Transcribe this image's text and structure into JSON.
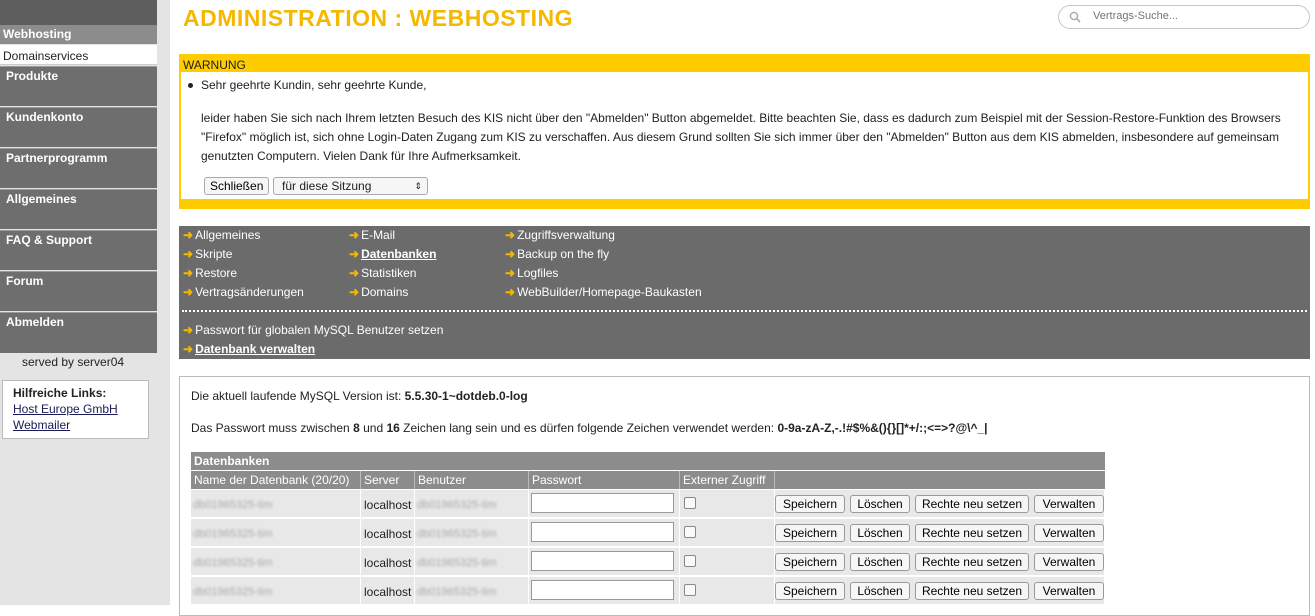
{
  "sidebar": {
    "active_section": "Webhosting",
    "sub_item": "Domainservices",
    "items": [
      "Produkte",
      "Kundenkonto",
      "Partnerprogramm",
      "Allgemeines",
      "FAQ & Support",
      "Forum",
      "Abmelden"
    ],
    "served_by": "served by server04",
    "links_title": "Hilfreiche Links:",
    "links": [
      "Host Europe GmbH",
      "Webmailer"
    ]
  },
  "header": {
    "title": "ADMINISTRATION : WEBHOSTING",
    "search_placeholder": "Vertrags-Suche..."
  },
  "warning": {
    "title": "WARNUNG",
    "greeting": "Sehr geehrte Kundin, sehr geehrte Kunde,",
    "text": "leider haben Sie sich nach Ihrem letzten Besuch des KIS nicht über den \"Abmelden\" Button abgemeldet. Bitte beachten Sie, dass es dadurch zum Beispiel mit der Session-Restore-Funktion des Browsers \"Firefox\" möglich ist, sich ohne Login-Daten Zugang zum KIS zu verschaffen. Aus diesem Grund sollten Sie sich immer über den \"Abmelden\" Button aus dem KIS abmelden, insbesondere auf gemeinsam genutzten Computern. Vielen Dank für Ihre Aufmerksamkeit.",
    "close_label": "Schließen",
    "session_option": "für diese Sitzung"
  },
  "nav": {
    "col1": [
      "Allgemeines",
      "Skripte",
      "Restore",
      "Vertragsänderungen"
    ],
    "col2": [
      "E-Mail",
      "Datenbanken",
      "Statistiken",
      "Domains"
    ],
    "col3": [
      "Zugriffsverwaltung",
      "Backup on the fly",
      "Logfiles",
      "WebBuilder/Homepage-Baukasten"
    ],
    "extra": [
      "Passwort für globalen MySQL Benutzer setzen",
      "Datenbank verwalten"
    ]
  },
  "content": {
    "version_label": "Die aktuell laufende MySQL Version ist:",
    "version_value": "5.5.30-1~dotdeb.0-log",
    "pw_rule_a": "Das Passwort muss zwischen",
    "pw_min": "8",
    "pw_rule_b": "und",
    "pw_max": "16",
    "pw_rule_c": "Zeichen lang sein und es dürfen folgende Zeichen verwendet werden:",
    "pw_chars": "0-9a-zA-Z,-.!#$%&(){}[]*+/:;<=>?@\\^_|",
    "table_title": "Datenbanken",
    "columns": [
      "Name der Datenbank (20/20)",
      "Server",
      "Benutzer",
      "Passwort",
      "Externer Zugriff"
    ],
    "rows": [
      {
        "name": "db01965325-tim",
        "server": "localhost",
        "user": "db01965325-tim"
      },
      {
        "name": "db01965325-tim",
        "server": "localhost",
        "user": "db01965325-tim"
      },
      {
        "name": "db01965325-tim",
        "server": "localhost",
        "user": "db01965325-tim"
      },
      {
        "name": "db01965325-tim",
        "server": "localhost",
        "user": "db01965325-tim"
      }
    ],
    "btn_save": "Speichern",
    "btn_delete": "Löschen",
    "btn_rights": "Rechte neu setzen",
    "btn_manage": "Verwalten"
  },
  "colors": {
    "accent": "#f5b800",
    "warning_bg": "#ffcc00",
    "nav_bg": "#6b6b6b"
  }
}
